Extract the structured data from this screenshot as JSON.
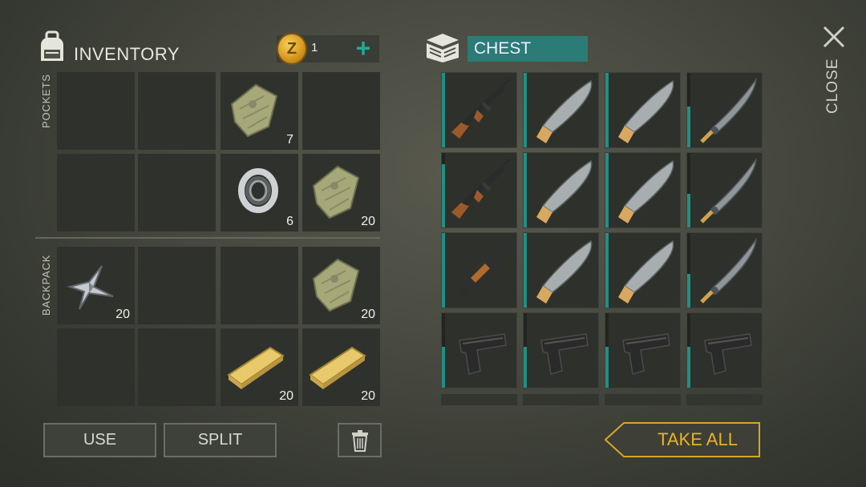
{
  "header": {
    "inventory_title": "INVENTORY",
    "coin_symbol": "Z",
    "coin_count": "1",
    "add_symbol": "+",
    "chest_title": "CHEST",
    "close_label": "CLOSE"
  },
  "sections": {
    "pockets_label": "POCKETS",
    "backpack_label": "BACKPACK"
  },
  "inventory": {
    "pockets": [
      {
        "item": "",
        "qty": ""
      },
      {
        "item": "",
        "qty": ""
      },
      {
        "item": "cloth",
        "qty": "7"
      },
      {
        "item": "",
        "qty": ""
      },
      {
        "item": "",
        "qty": ""
      },
      {
        "item": "",
        "qty": ""
      },
      {
        "item": "bearing",
        "qty": "6"
      },
      {
        "item": "cloth",
        "qty": "20"
      }
    ],
    "backpack": [
      {
        "item": "metal-scrap",
        "qty": "20"
      },
      {
        "item": "",
        "qty": ""
      },
      {
        "item": "",
        "qty": ""
      },
      {
        "item": "cloth",
        "qty": "20"
      },
      {
        "item": "",
        "qty": ""
      },
      {
        "item": "",
        "qty": ""
      },
      {
        "item": "wood-plank",
        "qty": "20"
      },
      {
        "item": "wood-plank",
        "qty": "20"
      }
    ]
  },
  "chest": {
    "rows": [
      [
        {
          "item": "rifle",
          "durability": 1.0
        },
        {
          "item": "machete",
          "durability": 1.0
        },
        {
          "item": "machete",
          "durability": 1.0
        },
        {
          "item": "katana",
          "durability": 0.55
        }
      ],
      [
        {
          "item": "rifle",
          "durability": 0.85
        },
        {
          "item": "machete",
          "durability": 1.0
        },
        {
          "item": "machete",
          "durability": 1.0
        },
        {
          "item": "katana",
          "durability": 0.45
        }
      ],
      [
        {
          "item": "shotgun",
          "durability": 1.0
        },
        {
          "item": "machete",
          "durability": 1.0
        },
        {
          "item": "machete",
          "durability": 1.0
        },
        {
          "item": "katana",
          "durability": 0.45
        }
      ],
      [
        {
          "item": "pistol",
          "durability": 0.55
        },
        {
          "item": "pistol",
          "durability": 0.55
        },
        {
          "item": "pistol",
          "durability": 0.55
        },
        {
          "item": "pistol",
          "durability": 0.55
        }
      ]
    ]
  },
  "buttons": {
    "use": "USE",
    "split": "SPLIT",
    "delete_icon": "trash-icon",
    "take_all": "TAKE ALL"
  },
  "colors": {
    "accent_teal": "#1f8f86",
    "chest_label_bg": "#2b7b76",
    "take_all_gold": "#e9b22a"
  }
}
